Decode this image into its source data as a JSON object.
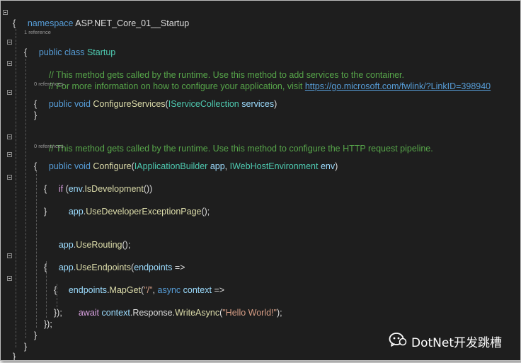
{
  "code": {
    "lines": {
      "l1": {
        "kw": "namespace",
        "rest": " ASP.NET_Core_01__Startup"
      },
      "l2": {
        "text": "{"
      },
      "l3_codelens": "1 reference",
      "l3": {
        "kw": "public class",
        "type": "Startup"
      },
      "l4": {
        "text": "{"
      },
      "l5": {
        "comment": "// This method gets called by the runtime. Use this method to add services to the container."
      },
      "l6": {
        "comment": "// For more information on how to configure your application, visit",
        "link": "https://go.microsoft.com/fwlink/?LinkID=398940"
      },
      "l7_codelens": "0 references",
      "l7": {
        "kw": "public void",
        "fn": "ConfigureServices",
        "open": "(",
        "type": "IServiceCollection",
        "param": "services",
        "close": ")"
      },
      "l8": {
        "text": "{"
      },
      "l9": {
        "text": "}"
      },
      "l10": {
        "comment": "// This method gets called by the runtime. Use this method to configure the HTTP request pipeline."
      },
      "l11_codelens": "0 references",
      "l11": {
        "kw": "public void",
        "fn": "Configure",
        "open": "(",
        "type1": "IApplicationBuilder",
        "param1": "app",
        "comma": ",",
        "type2": "IWebHostEnvironment",
        "param2": "env",
        "close": ")"
      },
      "l12": {
        "text": "{"
      },
      "l13": {
        "kw": "if",
        "open": " (",
        "param": "env",
        "dot": ".",
        "fn": "IsDevelopment",
        "close": "())"
      },
      "l14": {
        "text": "{"
      },
      "l15": {
        "param": "app",
        "dot": ".",
        "fn": "UseDeveloperExceptionPage",
        "close": "();"
      },
      "l16": {
        "text": "}"
      },
      "l17": {
        "param": "app",
        "dot": ".",
        "fn": "UseRouting",
        "close": "();"
      },
      "l18": {
        "param": "app",
        "dot": ".",
        "fn": "UseEndpoints",
        "open": "(",
        "param2": "endpoints",
        "arrow": " =>"
      },
      "l19": {
        "text": "{"
      },
      "l20": {
        "param": "endpoints",
        "dot": ".",
        "fn": "MapGet",
        "open": "(",
        "str": "\"/\"",
        "comma": ",",
        "kw": "async",
        "param2": "context",
        "arrow": " =>"
      },
      "l21": {
        "text": "{"
      },
      "l22": {
        "kw": "await",
        "param": "context",
        "dot": ".",
        "prop": "Response",
        "dot2": ".",
        "fn": "WriteAsync",
        "open": "(",
        "str": "\"Hello World!\"",
        "close": ");"
      },
      "l23": {
        "text": "});"
      },
      "l24": {
        "text": "});"
      },
      "l25": {
        "text": "}"
      },
      "l26": {
        "text": "}"
      },
      "l27": {
        "text": "}"
      }
    }
  },
  "watermark": {
    "text": "DotNet开发跳槽",
    "icon": "wechat-official-account-icon"
  },
  "colors": {
    "background": "#1e1e1e",
    "keyword": "#569cd6",
    "control_keyword": "#d8a0df",
    "type": "#4ec9b0",
    "method": "#dcdcaa",
    "parameter": "#9cdcfe",
    "comment": "#57a64a",
    "string": "#d69d85"
  }
}
